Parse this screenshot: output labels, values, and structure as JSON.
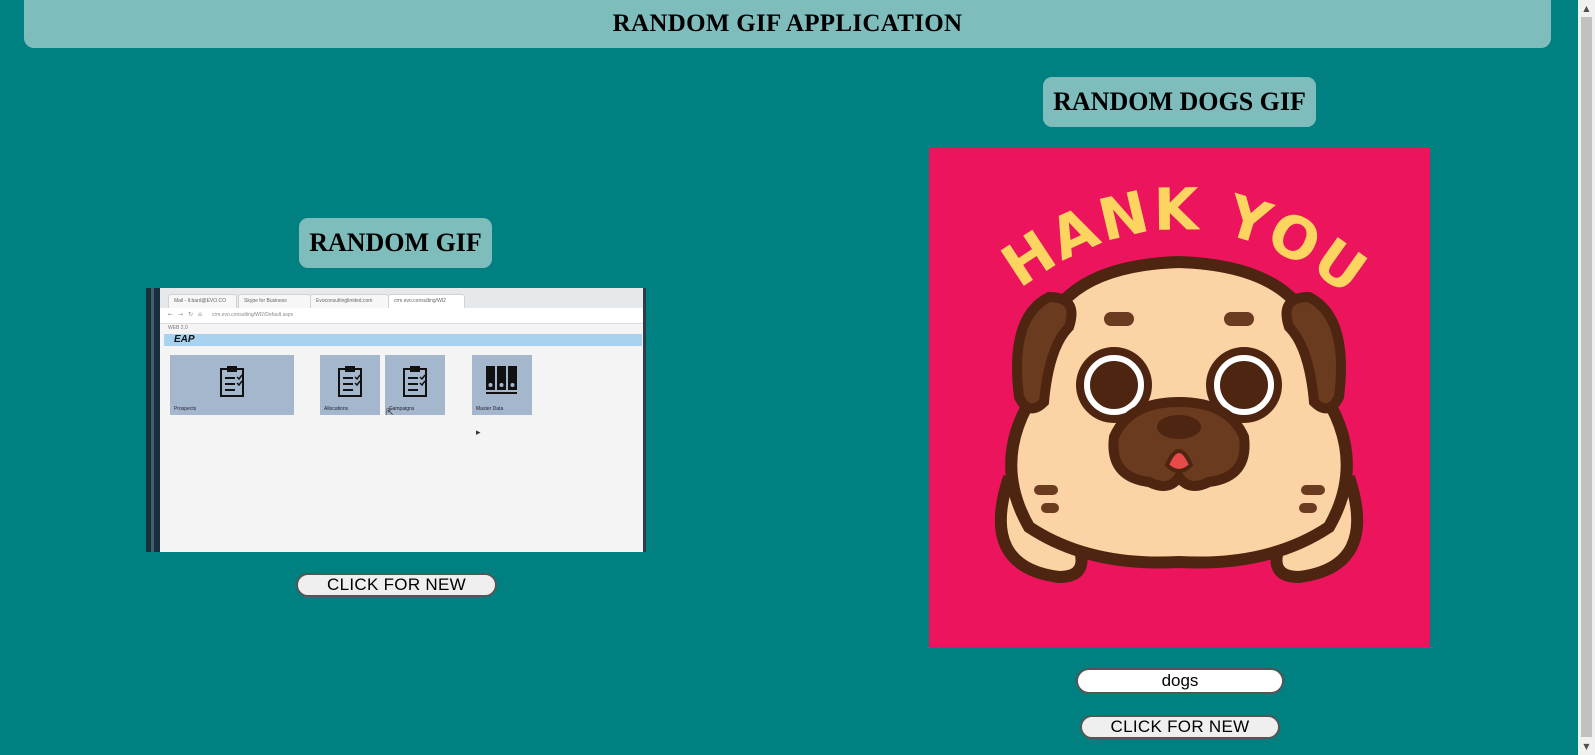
{
  "header": {
    "title": "RANDOM GIF APPLICATION"
  },
  "random_gif": {
    "title": "RANDOM GIF",
    "button_label": "CLICK FOR NEW",
    "preview": {
      "tabs": [
        "Mail - lt.bard@EVO.CO",
        "Skype for Business",
        "Evoconsultinglimited.com",
        "crm.evo.consulting/WI2"
      ],
      "url": "crm.evo.consulting/WI2/Default.aspx",
      "crumb": "WEB 2.0",
      "section": "EAP",
      "tiles": [
        {
          "label": "Prospects",
          "icon": "clipboard-icon"
        },
        {
          "label": "Allocations",
          "icon": "clipboard-icon"
        },
        {
          "label": "Campaigns",
          "icon": "clipboard-icon"
        },
        {
          "label": "Master Data",
          "icon": "binders-icon"
        }
      ]
    }
  },
  "dogs_gif": {
    "title": "RANDOM DOGS GIF",
    "image_text": "THANK YOU!",
    "search_value": "dogs",
    "button_label": "CLICK FOR NEW"
  },
  "colors": {
    "background": "#008080",
    "header_bg": "#7fbdbd",
    "gif_bg": "#ec155d",
    "thank_you_text": "#fcd560"
  }
}
